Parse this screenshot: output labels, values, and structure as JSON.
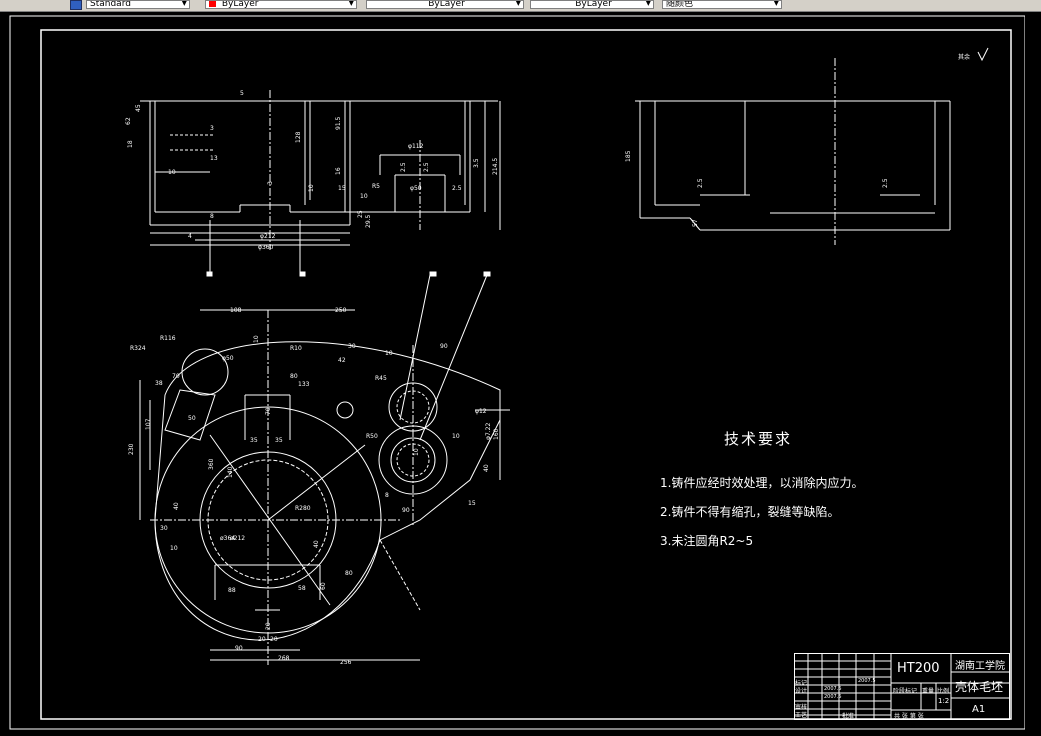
{
  "toolbar": {
    "style_combo": "Standard",
    "layer_combo": "ByLayer",
    "linetype_combo": "ByLayer",
    "lineweight_combo": "ByLayer",
    "color_combo": "随颜色",
    "layer_color": "#ff0000"
  },
  "drawing": {
    "roughness_note": "其余",
    "dims_top": [
      "5",
      "62",
      "45",
      "18",
      "10",
      "3",
      "13",
      "128",
      "91.5",
      "16",
      "10",
      "15",
      "10",
      "R5",
      "φ112",
      "2.5",
      "3.5",
      "φ50",
      "2.5",
      "2.5",
      "3",
      "214.5",
      "8",
      "φ212",
      "φ360",
      "4",
      "29.5",
      "25"
    ],
    "dims_right_view": [
      "185",
      "57",
      "2.5",
      "2.5"
    ],
    "dims_plan": [
      "108",
      "250",
      "R116",
      "R324",
      "10",
      "φ50",
      "R10",
      "30",
      "42",
      "10",
      "90",
      "80",
      "133",
      "R45",
      "70",
      "φ12",
      "R50",
      "10",
      "10",
      "35",
      "35",
      "360",
      "140",
      "ø212",
      "R280",
      "107",
      "230",
      "38",
      "50",
      "40",
      "30",
      "10",
      "8",
      "ø364",
      "90",
      "40",
      "88",
      "58",
      "60",
      "20",
      "20",
      "20",
      "90",
      "268",
      "256",
      "φ7.22",
      "160",
      "40",
      "15",
      "80",
      "70"
    ]
  },
  "requirements": {
    "title": "技术要求",
    "items": [
      "1.铸件应经时效处理，以消除内应力。",
      "2.铸件不得有缩孔，裂缝等缺陷。",
      "3.未注圆角R2~5"
    ]
  },
  "title_block": {
    "material": "HT200",
    "school": "湖南工学院",
    "part_name": "壳体毛坯",
    "scale": "1:2",
    "sheet_size": "A1",
    "stage_label": "阶段标记",
    "weight_label": "重量",
    "ratio_label": "比例",
    "sheets_label": "共  张  第  张",
    "rows": [
      "标记",
      "设计",
      "审核",
      "工艺"
    ],
    "dates": [
      "2007.5",
      "2007.5",
      "2007.5"
    ],
    "approve": "批准"
  }
}
